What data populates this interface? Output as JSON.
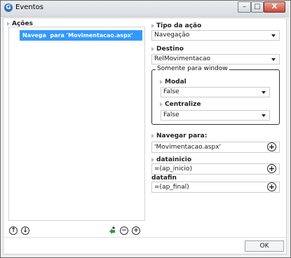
{
  "window": {
    "app_icon": "G",
    "title": "Eventos",
    "minimize": "–",
    "maximize": "□",
    "close": "X"
  },
  "acoes": {
    "label": "Ações",
    "items": [
      "Navega  para 'Movimentacao.aspx'"
    ],
    "buttons": {
      "move_up": "↑",
      "move_down": "↓",
      "add_event": "+",
      "remove": "−",
      "add": "+"
    }
  },
  "form": {
    "tipo_label": "Tipo da ação",
    "tipo_value": "Navegação",
    "destino_label": "Destino",
    "destino_value": "RelMovimentacao",
    "group_label": "Somente para window",
    "modal_label": "Modal",
    "modal_value": "False",
    "centralize_label": "Centralize",
    "centralize_value": "False",
    "navegar_label": "Navegar para:",
    "navegar_value": "'Movimentacao.aspx'",
    "datainicio_label": "datainicio",
    "datainicio_value": "=(ap_inicio)",
    "datafin_label": "datafin",
    "datafin_value": "=(ap_final)"
  },
  "footer": {
    "ok_label": "OK"
  }
}
